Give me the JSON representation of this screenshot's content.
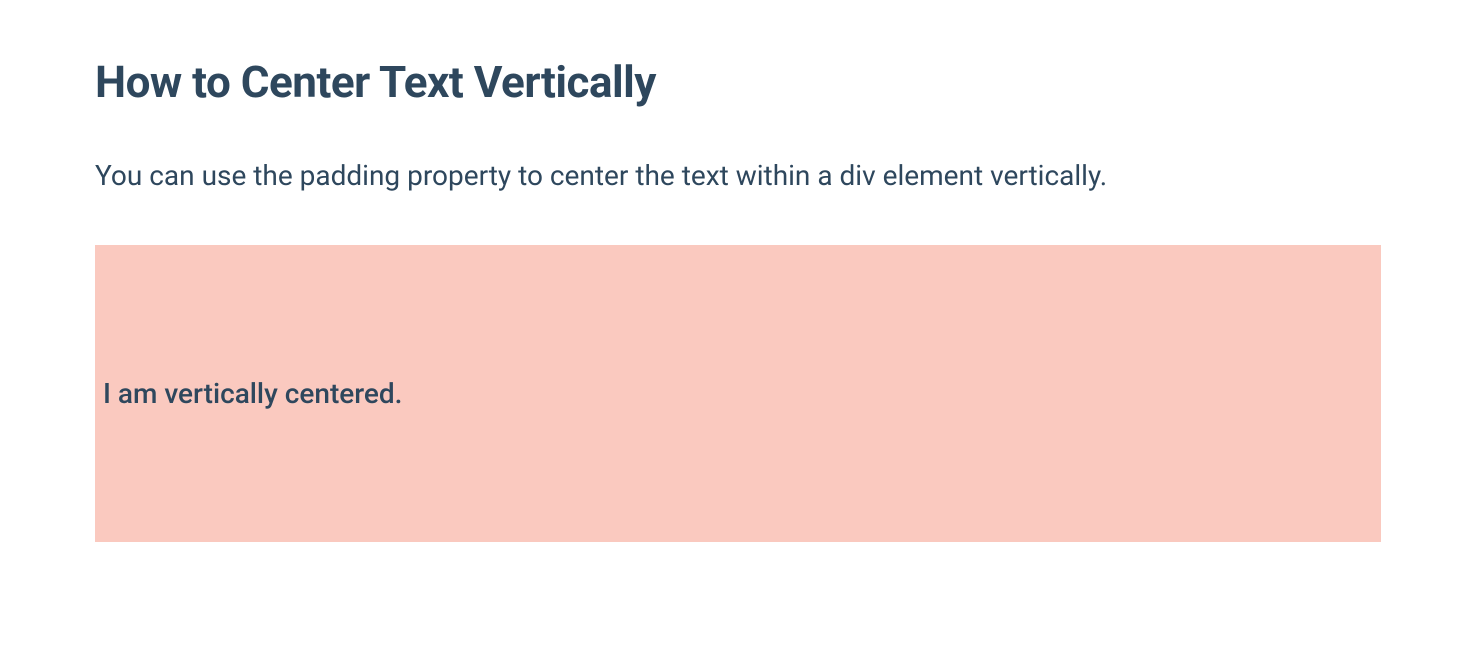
{
  "heading": "How to Center Text Vertically",
  "description": "You can use the padding property to center the text within a div element vertically.",
  "demo": {
    "text": "I am vertically centered."
  }
}
